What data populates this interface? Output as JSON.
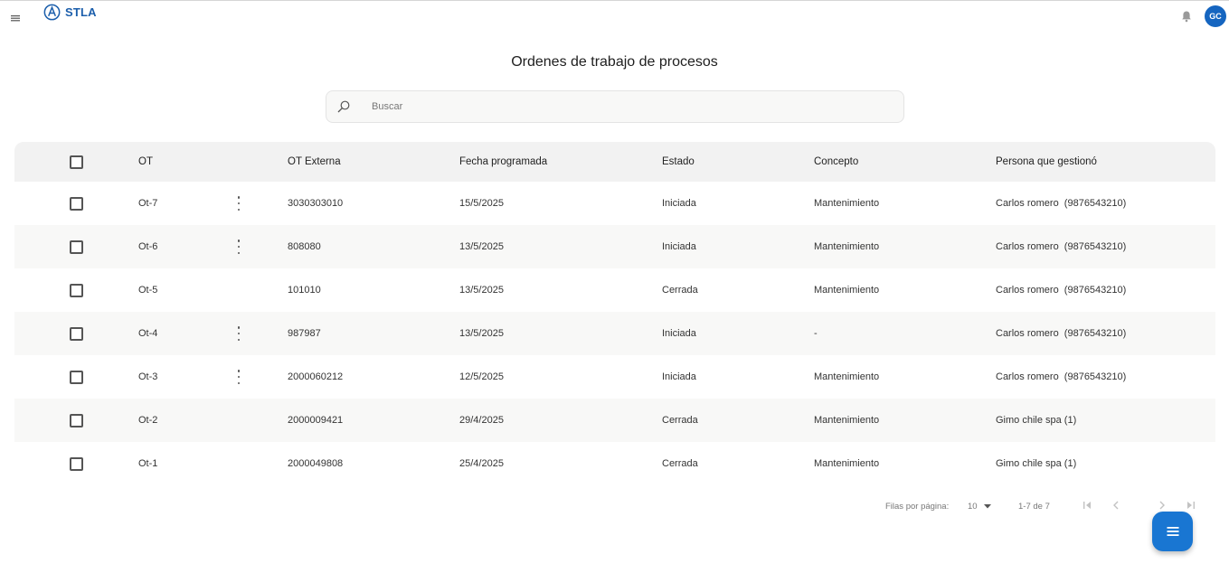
{
  "app": {
    "brand": "STLA",
    "user_initials": "GC"
  },
  "page": {
    "title": "Ordenes de trabajo de procesos"
  },
  "search": {
    "placeholder": "Buscar",
    "value": ""
  },
  "table": {
    "headers": {
      "ot": "OT",
      "ot_externa": "OT Externa",
      "fecha": "Fecha programada",
      "estado": "Estado",
      "concepto": "Concepto",
      "persona": "Persona que gestionó"
    },
    "rows": [
      {
        "ot": "Ot-7",
        "ot_externa": "3030303010",
        "fecha": "15/5/2025",
        "estado": "Iniciada",
        "concepto": "Mantenimiento",
        "persona": "Carlos romero  (9876543210)",
        "has_actions": true
      },
      {
        "ot": "Ot-6",
        "ot_externa": "808080",
        "fecha": "13/5/2025",
        "estado": "Iniciada",
        "concepto": "Mantenimiento",
        "persona": "Carlos romero  (9876543210)",
        "has_actions": true
      },
      {
        "ot": "Ot-5",
        "ot_externa": "101010",
        "fecha": "13/5/2025",
        "estado": "Cerrada",
        "concepto": "Mantenimiento",
        "persona": "Carlos romero  (9876543210)",
        "has_actions": false
      },
      {
        "ot": "Ot-4",
        "ot_externa": "987987",
        "fecha": "13/5/2025",
        "estado": "Iniciada",
        "concepto": "-",
        "persona": "Carlos romero  (9876543210)",
        "has_actions": true
      },
      {
        "ot": "Ot-3",
        "ot_externa": "2000060212",
        "fecha": "12/5/2025",
        "estado": "Iniciada",
        "concepto": "Mantenimiento",
        "persona": "Carlos romero  (9876543210)",
        "has_actions": true
      },
      {
        "ot": "Ot-2",
        "ot_externa": "2000009421",
        "fecha": "29/4/2025",
        "estado": "Cerrada",
        "concepto": "Mantenimiento",
        "persona": "Gimo chile spa (1)",
        "has_actions": false
      },
      {
        "ot": "Ot-1",
        "ot_externa": "2000049808",
        "fecha": "25/4/2025",
        "estado": "Cerrada",
        "concepto": "Mantenimiento",
        "persona": "Gimo chile spa (1)",
        "has_actions": false
      }
    ]
  },
  "pagination": {
    "rows_per_page_label": "Filas por página:",
    "rows_per_page": "10",
    "range": "1-7 de 7"
  },
  "icons": {
    "menu": "menu-icon",
    "logo": "stla-logo-icon",
    "bell": "bell-icon",
    "search": "search-icon",
    "first": "first-page-icon",
    "prev": "chevron-left-icon",
    "next": "chevron-right-icon",
    "last": "last-page-icon",
    "fab": "list-menu-icon"
  },
  "colors": {
    "brand": "#1b5eab",
    "avatar": "#1565c0",
    "fab": "#1976d2",
    "header_bg": "#f2f2f2",
    "alt_row_bg": "#f8f8f7"
  }
}
